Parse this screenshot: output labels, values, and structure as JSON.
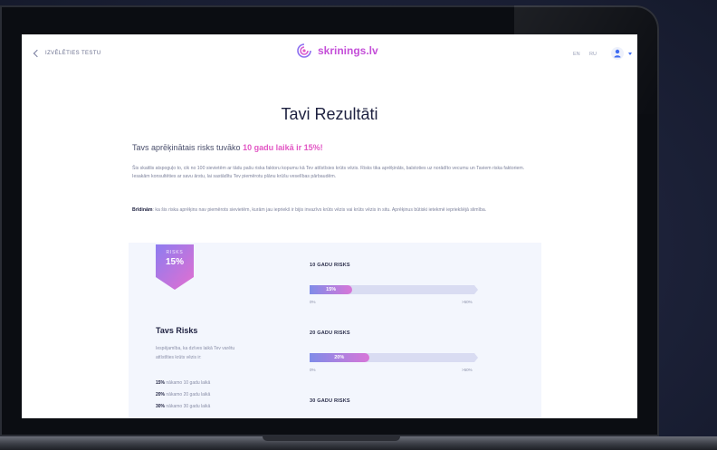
{
  "header": {
    "back_label": "IZVĒLĒTIES TESTU",
    "brand": "skrinings.lv",
    "lang_en": "EN",
    "lang_ru": "RU"
  },
  "main": {
    "title": "Tavi Rezultāti",
    "subtitle_prefix": "Tavs aprēķinātais risks tuvāko ",
    "subtitle_highlight": "10 gadu laikā ir 15%!",
    "intro": "Šis skaitlis atspoguļo to, cik no 100 sievietēm ar tādu pašu riska faktoru kopumu kā Tev attīstīsies krūts vēzis. Risks tika aprēķināts, balstoties uz norādīto vecumu un Taviem riska faktoriem. Iesakām konsultēties ar savu ārstu, lai sastādītu Tev piemērotu plānu krūšu veselības pārbaudēm.",
    "warning_label": "Brīdinām",
    "warning_text": ": ka šis riska aprēķins nav piemērots sievietēm, kurām jau iepriekš ir bijis invazīvs krūts vēzis vai krūts vēzis in situ. Aprēķinus būtiski ietekmē iepriekšējā slimība."
  },
  "results": {
    "badge_label": "RISKS",
    "badge_value": "15%",
    "risk_title": "Tavs Risks",
    "risk_desc": "Iespējamība, ka dzīves laikā Tev varētu attīstīties krūts vēzis ir:",
    "lines": [
      {
        "value": "15%",
        "text": " nākamo 10 gadu laikā"
      },
      {
        "value": "20%",
        "text": " nākamo 20 gadu laikā"
      },
      {
        "value": "30%",
        "text": " nākamo 30 gadu laikā"
      }
    ],
    "bars": [
      {
        "label": "10 GADU RISKS",
        "value_text": "15%",
        "fraction": 0.26,
        "min": "0%",
        "max": ">50%"
      },
      {
        "label": "20 GADU RISKS",
        "value_text": "20%",
        "fraction": 0.36,
        "min": "0%",
        "max": ">50%"
      },
      {
        "label": "30 GADU RISKS"
      }
    ]
  },
  "colors": {
    "brand": "#c44fd8",
    "highlight": "#e257c4",
    "bar_start": "#7f8ce8",
    "bar_end": "#d876d8",
    "track": "#d9dcf2",
    "accent": "#3f6cf2"
  }
}
